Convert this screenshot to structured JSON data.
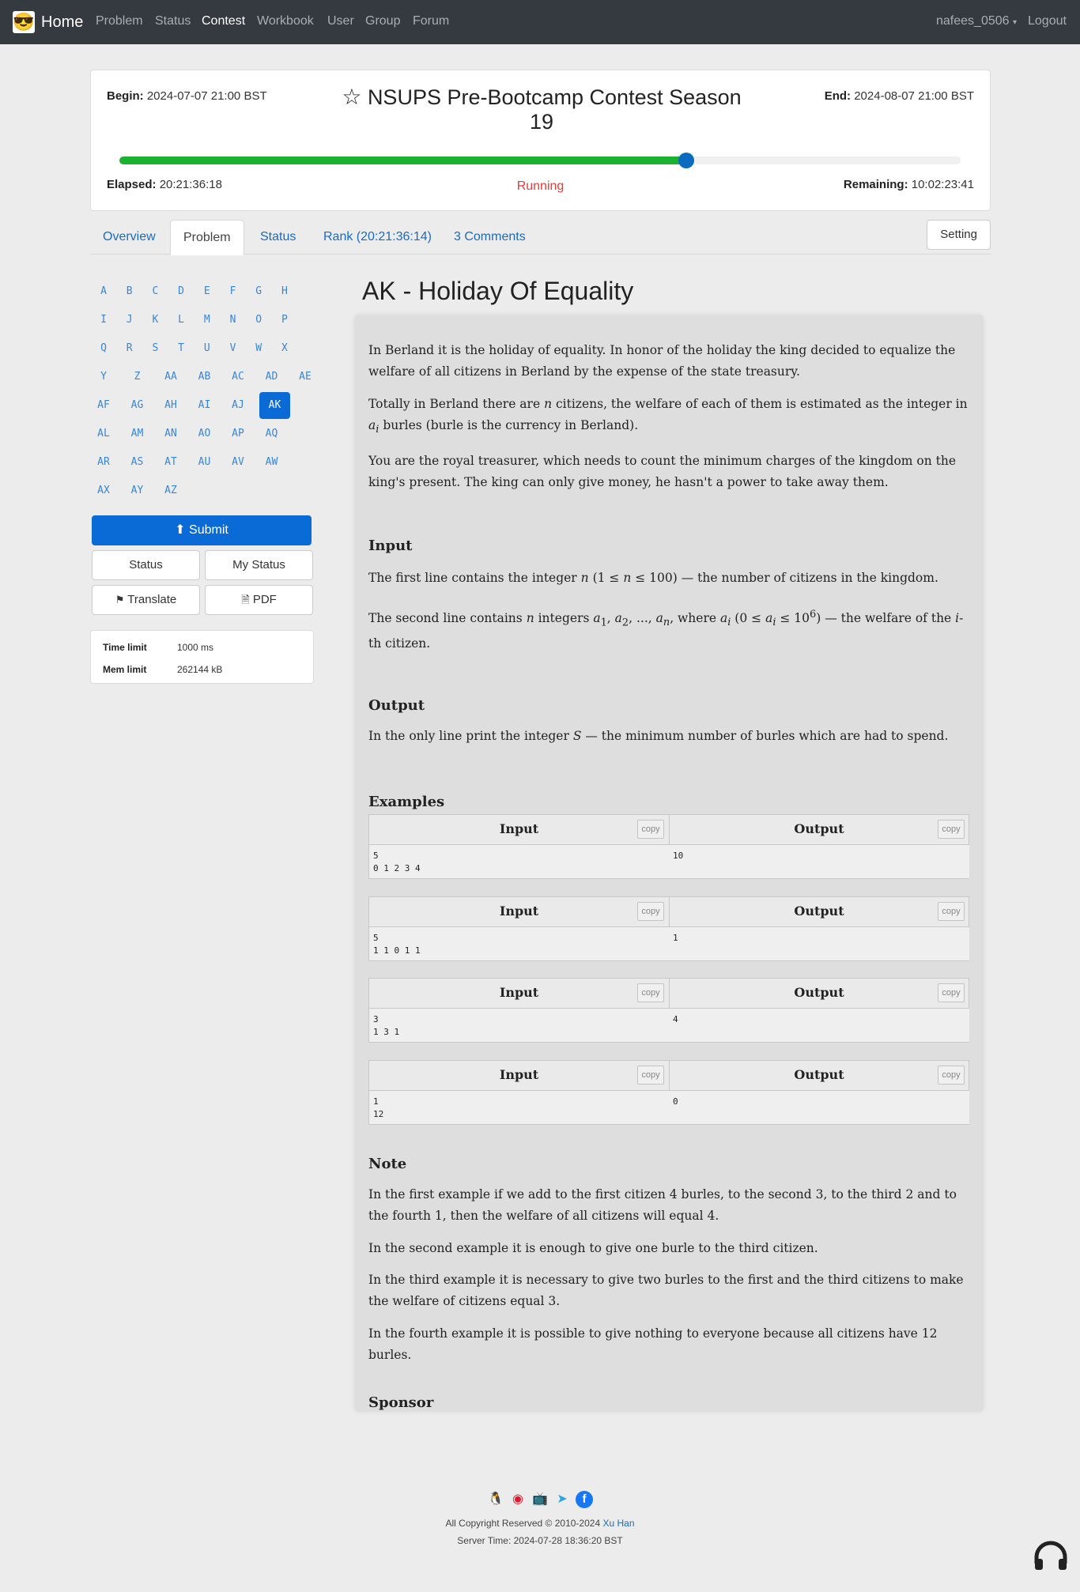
{
  "navbar": {
    "brand": "Home",
    "items": [
      "Problem",
      "Status",
      "Contest",
      "Workbook",
      "User",
      "Group",
      "Forum"
    ],
    "active": "Contest",
    "user": "nafees_0506",
    "logout": "Logout"
  },
  "contest": {
    "begin_label": "Begin:",
    "begin_value": "2024-07-07 21:00 BST",
    "end_label": "End:",
    "end_value": "2024-08-07 21:00 BST",
    "title": "NSUPS Pre-Bootcamp Contest Season 19",
    "progress_fraction": 0.674,
    "elapsed_label": "Elapsed:",
    "elapsed_value": "20:21:36:18",
    "status": "Running",
    "remaining_label": "Remaining:",
    "remaining_value": "10:02:23:41"
  },
  "tabs": {
    "overview": "Overview",
    "problem": "Problem",
    "status": "Status",
    "rank": "Rank (20:21:36:14)",
    "comments": "3 Comments",
    "setting": "Setting"
  },
  "letters": [
    "A",
    "B",
    "C",
    "D",
    "E",
    "F",
    "G",
    "H",
    "I",
    "J",
    "K",
    "L",
    "M",
    "N",
    "O",
    "P",
    "Q",
    "R",
    "S",
    "T",
    "U",
    "V",
    "W",
    "X",
    "Y",
    "Z",
    "AA",
    "AB",
    "AC",
    "AD",
    "AE",
    "AF",
    "AG",
    "AH",
    "AI",
    "AJ",
    "AK",
    "AL",
    "AM",
    "AN",
    "AO",
    "AP",
    "AQ",
    "AR",
    "AS",
    "AT",
    "AU",
    "AV",
    "AW",
    "AX",
    "AY",
    "AZ"
  ],
  "active_letter": "AK",
  "sidebar": {
    "submit": "Submit",
    "status": "Status",
    "my_status": "My Status",
    "translate": "Translate",
    "pdf": "PDF",
    "time_limit_label": "Time limit",
    "time_limit_value": "1000 ms",
    "mem_limit_label": "Mem limit",
    "mem_limit_value": "262144 kB"
  },
  "problem": {
    "title": "AK - Holiday Of Equality",
    "intro_1": "In Berland it is the holiday of equality. In honor of the holiday the king decided to equalize the welfare of all citizens in Berland by the expense of the state treasury.",
    "intro_2_a": "Totally in Berland there are ",
    "intro_2_b": " citizens, the welfare of each of them is estimated as the integer in ",
    "intro_2_c": " burles (burle is the currency in Berland).",
    "intro_3": "You are the royal treasurer, which needs to count the minimum charges of the kingdom on the king's present. The king can only give money, he hasn't a power to take away them.",
    "input_heading": "Input",
    "input_1_a": "The first line contains the integer ",
    "input_1_b": " (1 ≤ ",
    "input_1_c": " ≤ 100) — the number of citizens in the kingdom.",
    "input_2_a": "The second line contains ",
    "input_2_b": " integers ",
    "input_2_c": ", where ",
    "input_2_d": " (0 ≤ ",
    "input_2_e": " ≤ 10",
    "input_2_f": ") — the welfare of the ",
    "input_2_g": "-th citizen.",
    "output_heading": "Output",
    "output_a": "In the only line print the integer ",
    "output_b": " — the minimum number of burles which are had to spend.",
    "examples_heading": "Examples",
    "note_heading": "Note",
    "note_1": "In the first example if we add to the first citizen 4 burles, to the second 3, to the third 2 and to the fourth 1, then the welfare of all citizens will equal 4.",
    "note_2": "In the second example it is enough to give one burle to the third citizen.",
    "note_3": "In the third example it is necessary to give two burles to the first and the third citizens to make the welfare of citizens equal 3.",
    "note_4": "In the fourth example it is possible to give nothing to everyone because all citizens have 12 burles.",
    "sponsor_heading": "Sponsor"
  },
  "examples": {
    "input_label": "Input",
    "output_label": "Output",
    "copy_label": "copy",
    "items": [
      {
        "input": "5\n0 1 2 3 4",
        "output": "10"
      },
      {
        "input": "5\n1 1 0 1 1",
        "output": "1"
      },
      {
        "input": "3\n1 3 1",
        "output": "4"
      },
      {
        "input": "1\n12",
        "output": "0"
      }
    ]
  },
  "footer": {
    "copyright": "All Copyright Reserved © 2010-2024",
    "author": "Xu Han",
    "server_time": "Server Time: 2024-07-28 18:36:20 BST"
  }
}
